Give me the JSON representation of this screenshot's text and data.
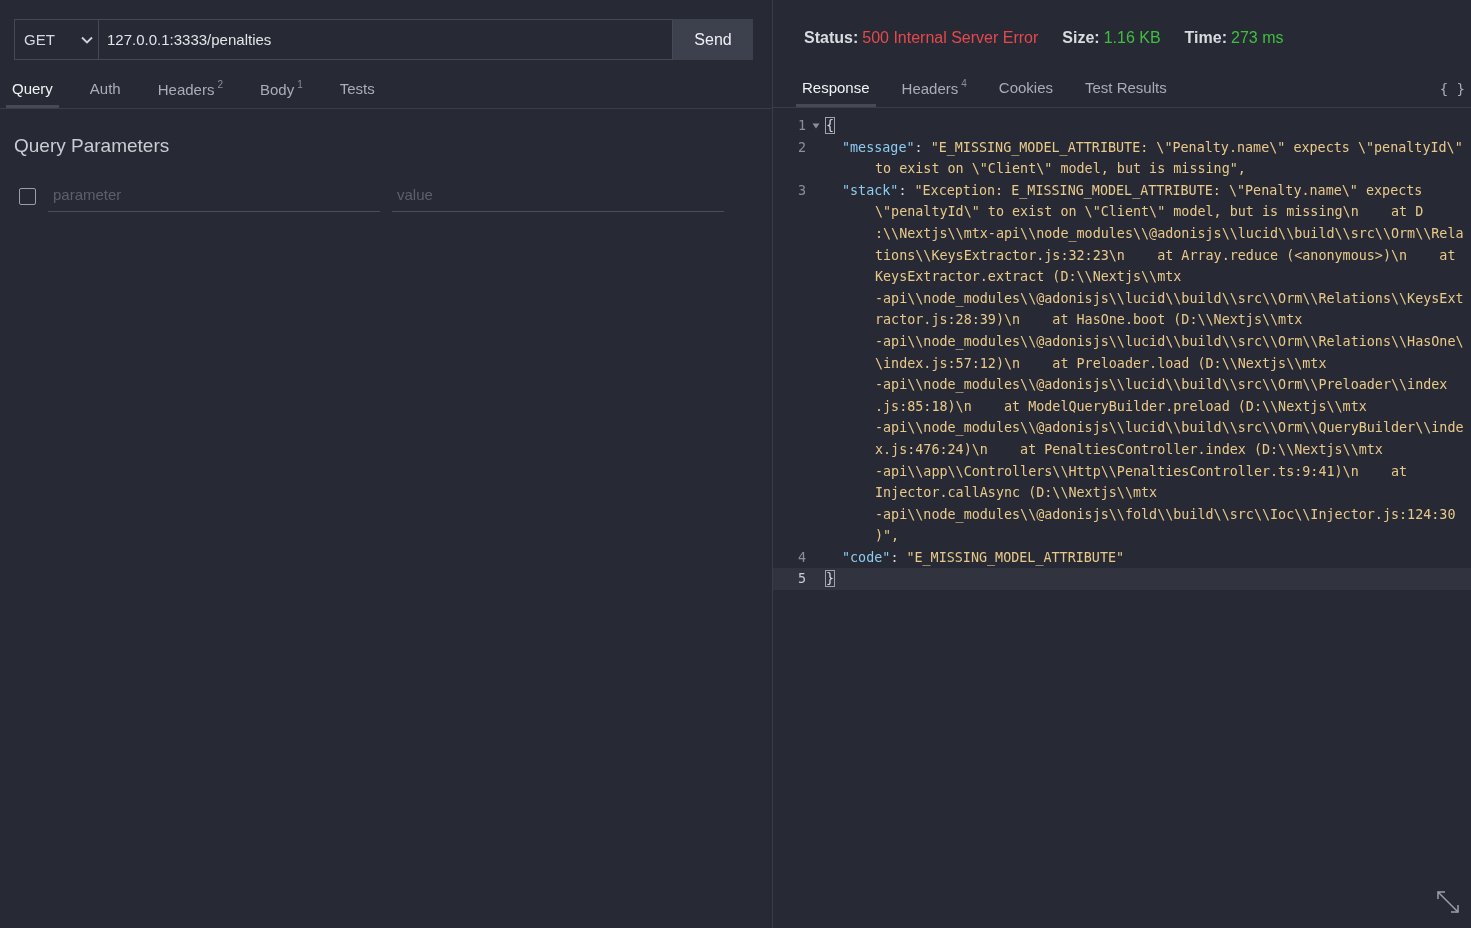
{
  "request": {
    "method": "GET",
    "url": "127.0.0.1:3333/penalties",
    "send": "Send"
  },
  "request_tabs": [
    {
      "label": "Query",
      "selected": true
    },
    {
      "label": "Auth",
      "selected": false
    },
    {
      "label": "Headers",
      "count": "2",
      "selected": false
    },
    {
      "label": "Body",
      "count": "1",
      "selected": false
    },
    {
      "label": "Tests",
      "selected": false
    }
  ],
  "query": {
    "title": "Query Parameters",
    "rows": [
      {
        "checked": false,
        "name_placeholder": "parameter",
        "value_placeholder": "value"
      }
    ]
  },
  "status": [
    {
      "label": "Status:",
      "value": "500 Internal Server Error",
      "kind": "error"
    },
    {
      "label": "Size:",
      "value": "1.16 KB",
      "kind": "ok"
    },
    {
      "label": "Time:",
      "value": "273 ms",
      "kind": "ok"
    }
  ],
  "response_tabs": [
    {
      "label": "Response",
      "selected": true
    },
    {
      "label": "Headers",
      "count": "4",
      "selected": false
    },
    {
      "label": "Cookies",
      "selected": false
    },
    {
      "label": "Test Results",
      "selected": false
    }
  ],
  "format_toggle": "{ }",
  "code": {
    "lines": [
      {
        "number": "1",
        "kind": "brace",
        "text": "{",
        "expanded": true,
        "bracket_match": true,
        "current": false
      },
      {
        "number": "2",
        "kind": "pair",
        "key": "\"message\"",
        "separator": ":",
        "rows": [
          "\"E_MISSING_MODEL_ATTRIBUTE: \\\"Penalty.name\\\" expects \\\"penaltyId\\\"",
          "to exist on \\\"Client\\\" model, but is missing\","
        ],
        "current": false
      },
      {
        "number": "3",
        "kind": "pair",
        "key": "\"stack\"",
        "separator": ":",
        "rows": [
          "\"Exception: E_MISSING_MODEL_ATTRIBUTE: \\\"Penalty.name\\\" expects",
          "\\\"penaltyId\\\" to exist on \\\"Client\\\" model, but is missing\\n    at D",
          ":\\\\Nextjs\\\\mtx-api\\\\node_modules\\\\@adonisjs\\\\lucid\\\\build\\\\src\\\\Orm\\\\Rela",
          "tions\\\\KeysExtractor.js:32:23\\n    at Array.reduce (<anonymous>)\\n    at",
          "KeysExtractor.extract (D:\\\\Nextjs\\\\mtx",
          "-api\\\\node_modules\\\\@adonisjs\\\\lucid\\\\build\\\\src\\\\Orm\\\\Relations\\\\KeysExt",
          "ractor.js:28:39)\\n    at HasOne.boot (D:\\\\Nextjs\\\\mtx",
          "-api\\\\node_modules\\\\@adonisjs\\\\lucid\\\\build\\\\src\\\\Orm\\\\Relations\\\\HasOne\\",
          "\\index.js:57:12)\\n    at Preloader.load (D:\\\\Nextjs\\\\mtx",
          "-api\\\\node_modules\\\\@adonisjs\\\\lucid\\\\build\\\\src\\\\Orm\\\\Preloader\\\\index",
          ".js:85:18)\\n    at ModelQueryBuilder.preload (D:\\\\Nextjs\\\\mtx",
          "-api\\\\node_modules\\\\@adonisjs\\\\lucid\\\\build\\\\src\\\\Orm\\\\QueryBuilder\\\\inde",
          "x.js:476:24)\\n    at PenaltiesController.index (D:\\\\Nextjs\\\\mtx",
          "-api\\\\app\\\\Controllers\\\\Http\\\\PenaltiesController.ts:9:41)\\n    at",
          "Injector.callAsync (D:\\\\Nextjs\\\\mtx",
          "-api\\\\node_modules\\\\@adonisjs\\\\fold\\\\build\\\\src\\\\Ioc\\\\Injector.js:124:30",
          ")\","
        ],
        "current": false
      },
      {
        "number": "4",
        "kind": "pair",
        "key": "\"code\"",
        "separator": ":",
        "rows": [
          "\"E_MISSING_MODEL_ATTRIBUTE\""
        ],
        "current": false
      },
      {
        "number": "5",
        "kind": "brace",
        "text": "}",
        "expanded": false,
        "bracket_match": true,
        "current": true
      }
    ]
  }
}
